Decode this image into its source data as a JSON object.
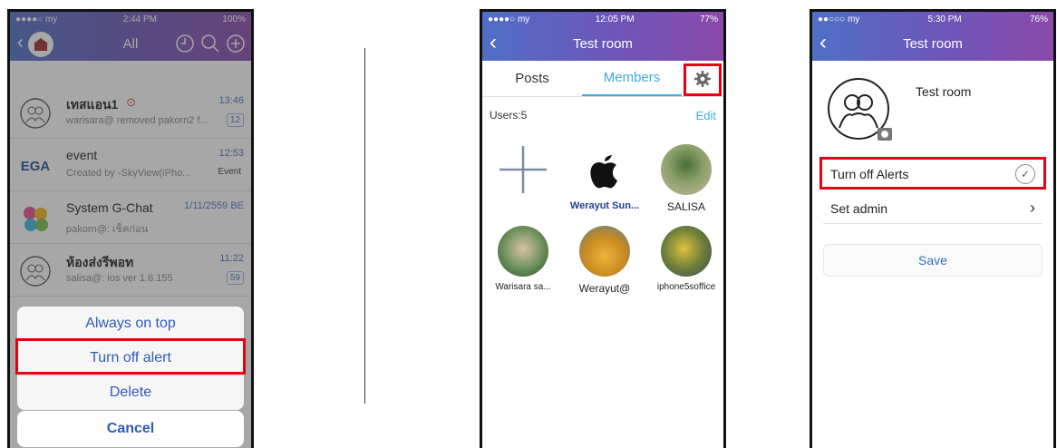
{
  "screen1": {
    "status": {
      "carrier": "●●●●○ my",
      "time": "2:44 PM",
      "battery": "100%"
    },
    "nav_title": "All",
    "chats": [
      {
        "name": "เทสแอน1",
        "preview": "warisara@ removed pakorn2 f...",
        "time": "13:46",
        "badge": "12"
      },
      {
        "name": "event",
        "preview": "Created by -SkyView(iPho...",
        "time": "12:53",
        "badge": "Event"
      },
      {
        "name": "System G-Chat",
        "preview": "pakorn@: เช็คก่อน",
        "time": "1/11/2559 BE",
        "badge": ""
      },
      {
        "name": "ห้องส่งรีพอท",
        "preview": "salisa@: ios ver 1.6.155",
        "time": "11:22",
        "badge": "59"
      }
    ],
    "event_logo": "EGA",
    "sheet": {
      "always_on_top": "Always on top",
      "turn_off_alert": "Turn off alert",
      "delete": "Delete",
      "cancel": "Cancel"
    }
  },
  "screen2": {
    "status": {
      "carrier": "●●●●○ my",
      "time": "12:05 PM",
      "battery": "77%"
    },
    "nav_title": "Test room",
    "tabs": {
      "posts": "Posts",
      "members": "Members"
    },
    "users_count": "Users:5",
    "edit": "Edit",
    "members": [
      "Werayut Sun...",
      "SALISA",
      "Warisara sa...",
      "Werayut@",
      "iphone5soffice"
    ]
  },
  "screen3": {
    "status": {
      "carrier": "●●○○○ my",
      "time": "5:30 PM",
      "battery": "76%"
    },
    "nav_title": "Test room",
    "room_name": "Test room",
    "turn_off_alerts": "Turn off Alerts",
    "set_admin": "Set admin",
    "save": "Save"
  },
  "colors": {
    "highlight": "#e60012",
    "accent": "#3fa9e0",
    "nav_gradient_start": "#4f6fc6",
    "nav_gradient_end": "#8a4aaa"
  }
}
